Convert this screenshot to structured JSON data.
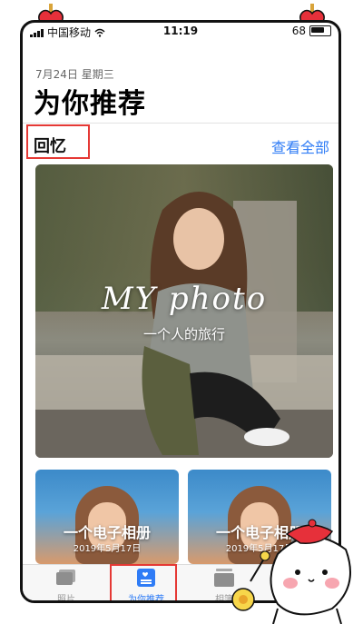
{
  "status_bar": {
    "carrier": "中国移动",
    "time": "11:19",
    "battery": "68"
  },
  "header": {
    "date": "7月24日 星期三",
    "title": "为你推荐"
  },
  "memories": {
    "section_title": "回忆",
    "see_all": "查看全部",
    "hero": {
      "title": "MY photo",
      "subtitle": "一个人的旅行"
    },
    "cards": [
      {
        "title": "一个电子相册",
        "date": "2019年5月17日"
      },
      {
        "title": "一个电子相册",
        "date": "2019年5月17日"
      }
    ]
  },
  "tabbar": {
    "items": [
      {
        "label": "照片",
        "icon": "photos-icon"
      },
      {
        "label": "为你推荐",
        "icon": "for-you-icon",
        "selected": true
      },
      {
        "label": "相簿",
        "icon": "albums-icon"
      }
    ]
  },
  "colors": {
    "accent": "#2f7cf6",
    "highlight_box": "#e53935"
  }
}
